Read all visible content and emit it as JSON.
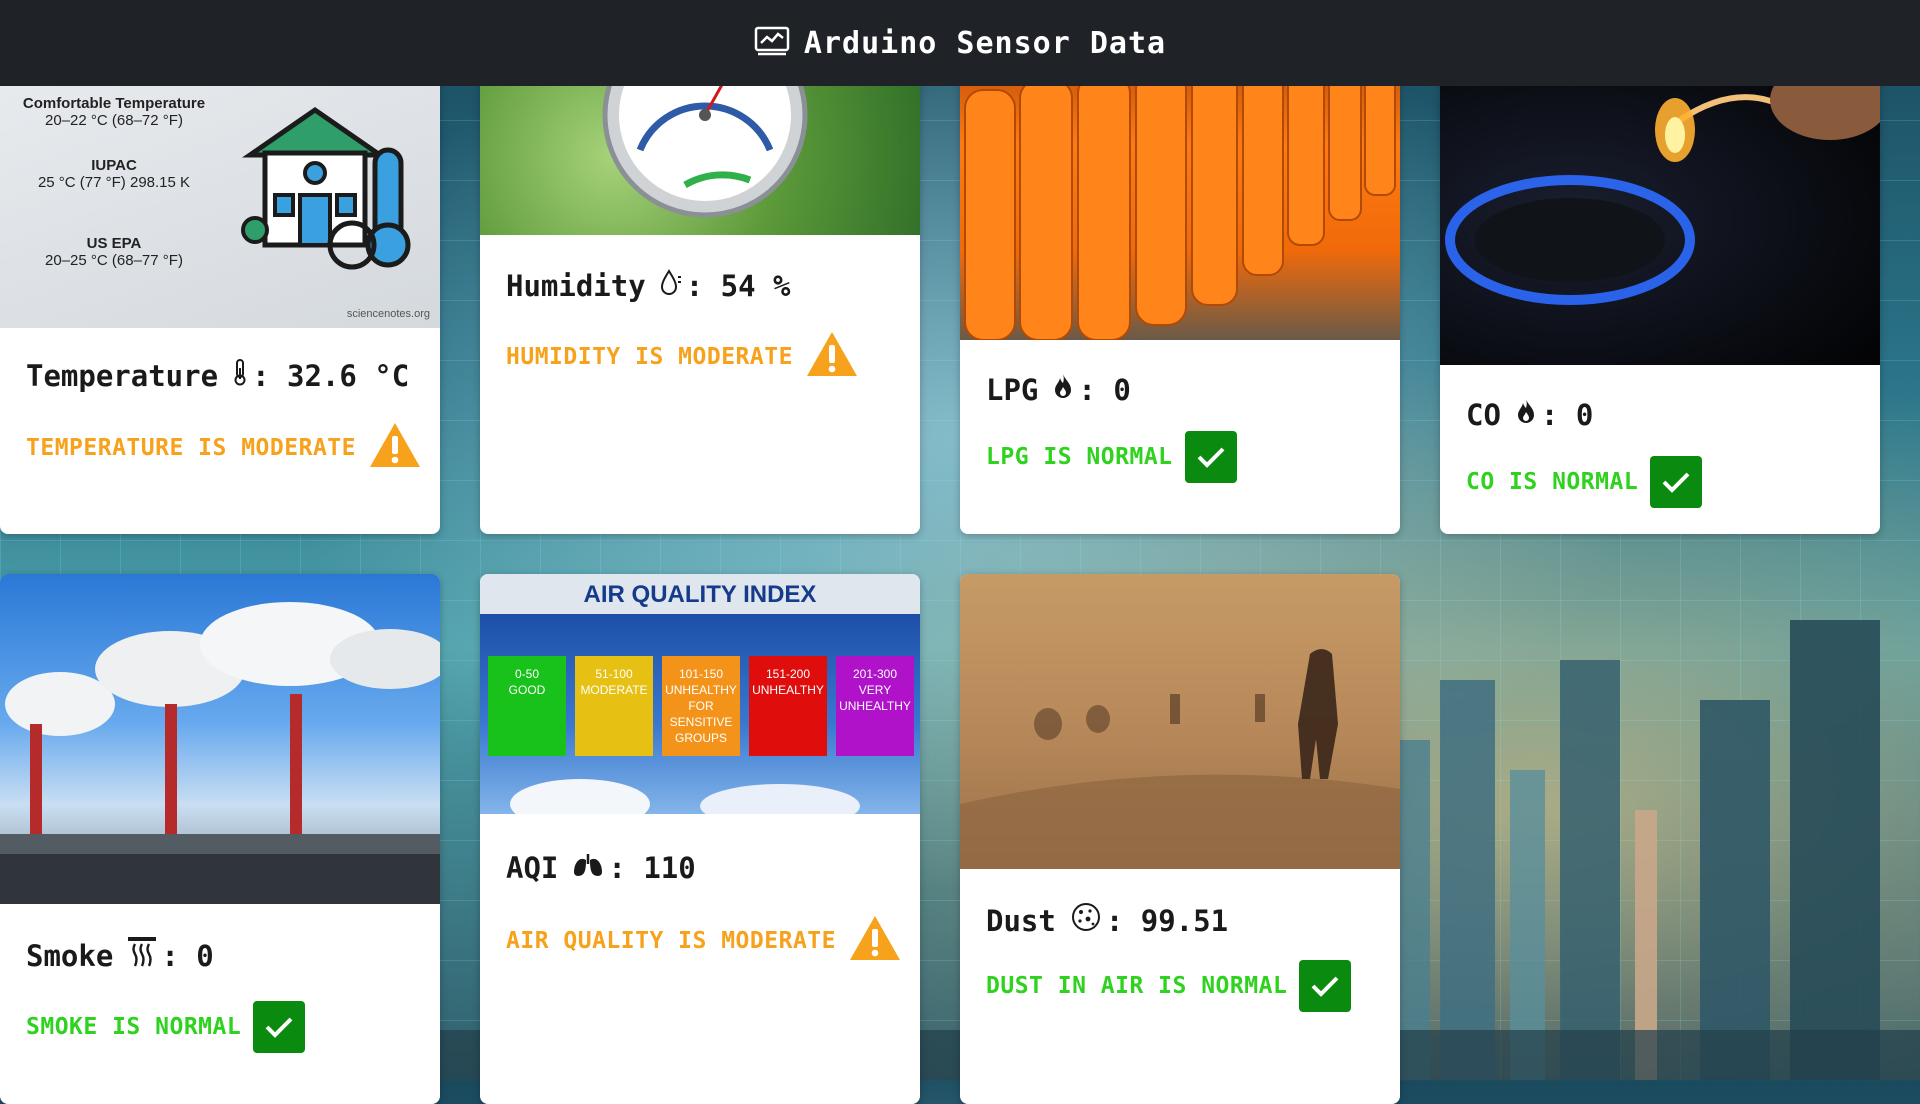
{
  "header": {
    "title": "Arduino Sensor Data",
    "icon": "chart-monitor-icon"
  },
  "cards": {
    "temperature": {
      "label": "Temperature",
      "value": "32.6 °C",
      "icon": "thermometer-icon",
      "status": "TEMPERATURE IS MODERATE",
      "status_kind": "moderate",
      "image_text": {
        "title": "Comfortable Temperature",
        "range1": "20–22 °C (68–72 °F)",
        "label2": "IUPAC",
        "range2": "25 °C (77 °F) 298.15 K",
        "label3": "US EPA",
        "range3": "20–25 °C (68–77 °F)",
        "credit": "sciencenotes.org"
      }
    },
    "humidity": {
      "label": "Humidity",
      "value": "54 %",
      "icon": "droplet-icon",
      "status": "HUMIDITY IS MODERATE",
      "status_kind": "moderate"
    },
    "lpg": {
      "label": "LPG",
      "value": "0",
      "icon": "flame-icon",
      "status": "LPG IS NORMAL",
      "status_kind": "normal"
    },
    "co": {
      "label": "CO",
      "value": "0",
      "icon": "flame-icon",
      "status": "CO IS NORMAL",
      "status_kind": "normal"
    },
    "smoke": {
      "label": "Smoke",
      "value": "0",
      "icon": "smoke-icon",
      "status": "SMOKE IS NORMAL",
      "status_kind": "normal"
    },
    "aqi": {
      "label": "AQI",
      "value": "110",
      "icon": "lungs-icon",
      "status": "AIR QUALITY IS MODERATE",
      "status_kind": "moderate",
      "image_text": {
        "title": "AIR QUALITY INDEX",
        "bands": [
          {
            "range": "0-50",
            "name": "GOOD",
            "color": "#18c21a"
          },
          {
            "range": "51-100",
            "name": "MODERATE",
            "color": "#e6c012"
          },
          {
            "range": "101-150",
            "name": "UNHEALTHY FOR SENSITIVE GROUPS",
            "color": "#f4931a"
          },
          {
            "range": "151-200",
            "name": "UNHEALTHY",
            "color": "#e00d0d"
          },
          {
            "range": "201-300",
            "name": "VERY UNHEALTHY",
            "color": "#b012c9"
          }
        ]
      }
    },
    "dust": {
      "label": "Dust",
      "value": "99.51",
      "icon": "dust-particles-icon",
      "status": "DUST IN AIR IS NORMAL",
      "status_kind": "normal"
    }
  },
  "colors": {
    "moderate": "#f6a21c",
    "normal": "#2fd21f",
    "check_bg": "#0b8a10",
    "header_bg": "#1f2226"
  }
}
